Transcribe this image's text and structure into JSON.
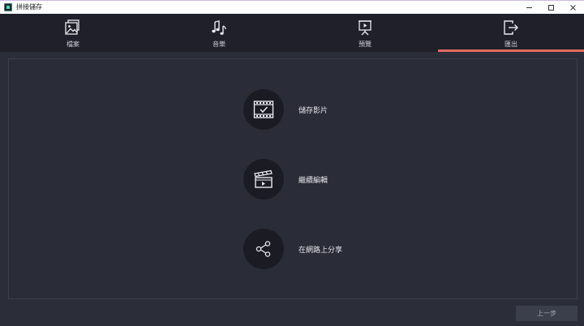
{
  "window": {
    "title": "拼接儲存",
    "controls": [
      "minimize",
      "maximize",
      "close"
    ]
  },
  "tabs": [
    {
      "id": "files",
      "label": "檔案",
      "icon": "files-icon",
      "active": false
    },
    {
      "id": "music",
      "label": "音樂",
      "icon": "music-icon",
      "active": false
    },
    {
      "id": "preview",
      "label": "預覽",
      "icon": "preview-icon",
      "active": false
    },
    {
      "id": "export",
      "label": "匯出",
      "icon": "export-icon",
      "active": true
    }
  ],
  "options": {
    "save": {
      "label": "儲存影片",
      "icon": "film-check-icon"
    },
    "continue": {
      "label": "繼續編輯",
      "icon": "clapperboard-icon"
    },
    "share": {
      "label": "在網路上分享",
      "icon": "share-icon"
    }
  },
  "footer": {
    "back_label": "上一步"
  },
  "colors": {
    "accent": "#e26a5c",
    "toolbar_bg": "#1f2029",
    "panel_bg": "#2a2c37",
    "circle_bg": "#1b1c23"
  }
}
